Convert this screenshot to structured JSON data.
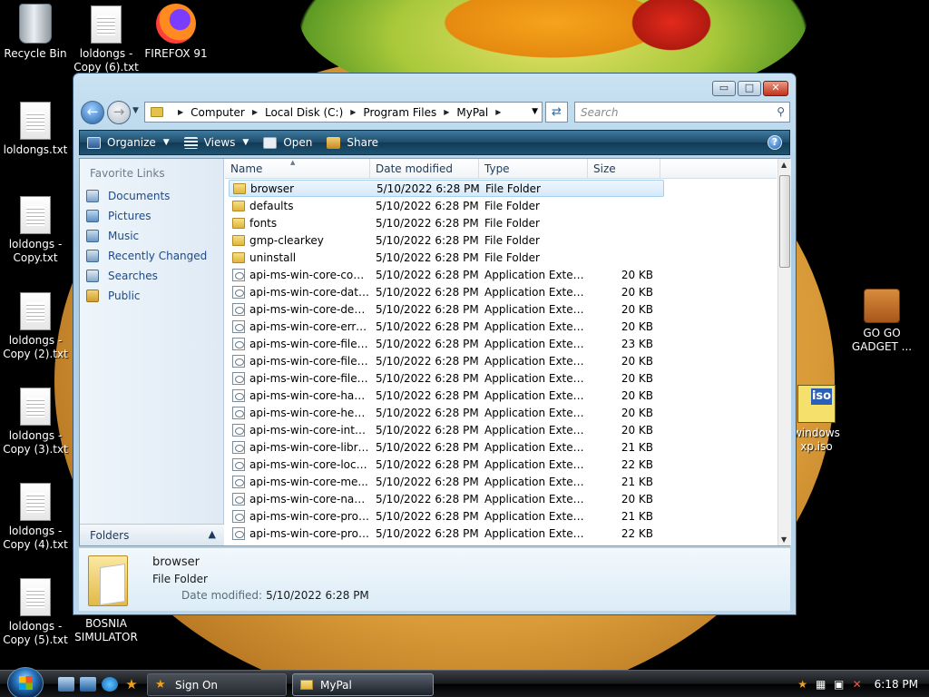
{
  "desktop": {
    "icons": [
      {
        "label": "Recycle Bin"
      },
      {
        "label": "loldongs - Copy (6).txt"
      },
      {
        "label": "FIREFOX 91"
      },
      {
        "label": "loldongs.txt"
      },
      {
        "label": "loldongs - Copy.txt"
      },
      {
        "label": "loldongs - Copy (2).txt"
      },
      {
        "label": "loldongs - Copy (3).txt"
      },
      {
        "label": "loldongs - Copy (4).txt"
      },
      {
        "label": "loldongs - Copy (5).txt"
      },
      {
        "label": "BOSNIA SIMULATOR"
      },
      {
        "label": "GO GO GADGET ..."
      },
      {
        "label": "windows xp.iso",
        "badge": "iso"
      }
    ]
  },
  "explorer": {
    "breadcrumb": [
      "Computer",
      "Local Disk (C:)",
      "Program Files",
      "MyPal"
    ],
    "search_placeholder": "Search",
    "toolbar": {
      "organize": "Organize",
      "views": "Views",
      "open": "Open",
      "share": "Share",
      "help": "?"
    },
    "caption": {
      "minimize": "▭",
      "maximize": "□",
      "close": "✕"
    },
    "favorite_links_title": "Favorite Links",
    "favorite_links": [
      "Documents",
      "Pictures",
      "Music",
      "Recently Changed",
      "Searches",
      "Public"
    ],
    "folders_label": "Folders",
    "columns": [
      "Name",
      "Date modified",
      "Type",
      "Size"
    ],
    "files": [
      {
        "name": "browser",
        "date": "5/10/2022 6:28 PM",
        "type": "File Folder",
        "size": "",
        "kind": "folder"
      },
      {
        "name": "defaults",
        "date": "5/10/2022 6:28 PM",
        "type": "File Folder",
        "size": "",
        "kind": "folder"
      },
      {
        "name": "fonts",
        "date": "5/10/2022 6:28 PM",
        "type": "File Folder",
        "size": "",
        "kind": "folder"
      },
      {
        "name": "gmp-clearkey",
        "date": "5/10/2022 6:28 PM",
        "type": "File Folder",
        "size": "",
        "kind": "folder"
      },
      {
        "name": "uninstall",
        "date": "5/10/2022 6:28 PM",
        "type": "File Folder",
        "size": "",
        "kind": "folder"
      },
      {
        "name": "api-ms-win-core-cons...",
        "date": "5/10/2022 6:28 PM",
        "type": "Application Extens...",
        "size": "20 KB",
        "kind": "dll"
      },
      {
        "name": "api-ms-win-core-datet...",
        "date": "5/10/2022 6:28 PM",
        "type": "Application Extens...",
        "size": "20 KB",
        "kind": "dll"
      },
      {
        "name": "api-ms-win-core-debu...",
        "date": "5/10/2022 6:28 PM",
        "type": "Application Extens...",
        "size": "20 KB",
        "kind": "dll"
      },
      {
        "name": "api-ms-win-core-error...",
        "date": "5/10/2022 6:28 PM",
        "type": "Application Extens...",
        "size": "20 KB",
        "kind": "dll"
      },
      {
        "name": "api-ms-win-core-file-l...",
        "date": "5/10/2022 6:28 PM",
        "type": "Application Extens...",
        "size": "23 KB",
        "kind": "dll"
      },
      {
        "name": "api-ms-win-core-file-l...",
        "date": "5/10/2022 6:28 PM",
        "type": "Application Extens...",
        "size": "20 KB",
        "kind": "dll"
      },
      {
        "name": "api-ms-win-core-file-l...",
        "date": "5/10/2022 6:28 PM",
        "type": "Application Extens...",
        "size": "20 KB",
        "kind": "dll"
      },
      {
        "name": "api-ms-win-core-hand...",
        "date": "5/10/2022 6:28 PM",
        "type": "Application Extens...",
        "size": "20 KB",
        "kind": "dll"
      },
      {
        "name": "api-ms-win-core-heap...",
        "date": "5/10/2022 6:28 PM",
        "type": "Application Extens...",
        "size": "20 KB",
        "kind": "dll"
      },
      {
        "name": "api-ms-win-core-interl...",
        "date": "5/10/2022 6:28 PM",
        "type": "Application Extens...",
        "size": "20 KB",
        "kind": "dll"
      },
      {
        "name": "api-ms-win-core-librar...",
        "date": "5/10/2022 6:28 PM",
        "type": "Application Extens...",
        "size": "21 KB",
        "kind": "dll"
      },
      {
        "name": "api-ms-win-core-local...",
        "date": "5/10/2022 6:28 PM",
        "type": "Application Extens...",
        "size": "22 KB",
        "kind": "dll"
      },
      {
        "name": "api-ms-win-core-me...",
        "date": "5/10/2022 6:28 PM",
        "type": "Application Extens...",
        "size": "21 KB",
        "kind": "dll"
      },
      {
        "name": "api-ms-win-core-nam...",
        "date": "5/10/2022 6:28 PM",
        "type": "Application Extens...",
        "size": "20 KB",
        "kind": "dll"
      },
      {
        "name": "api-ms-win-core-proc...",
        "date": "5/10/2022 6:28 PM",
        "type": "Application Extens...",
        "size": "21 KB",
        "kind": "dll"
      },
      {
        "name": "api-ms-win-core-proc...",
        "date": "5/10/2022 6:28 PM",
        "type": "Application Extens...",
        "size": "22 KB",
        "kind": "dll"
      }
    ],
    "details": {
      "name": "browser",
      "type": "File Folder",
      "modified_label": "Date modified:",
      "modified_value": "5/10/2022 6:28 PM"
    }
  },
  "taskbar": {
    "buttons": [
      {
        "label": "Sign On"
      },
      {
        "label": "MyPal"
      }
    ],
    "clock": "6:18 PM"
  },
  "colors": {
    "accent": "#1d4a68",
    "selection": "#d5e9fa",
    "link": "#1a4b8c"
  }
}
